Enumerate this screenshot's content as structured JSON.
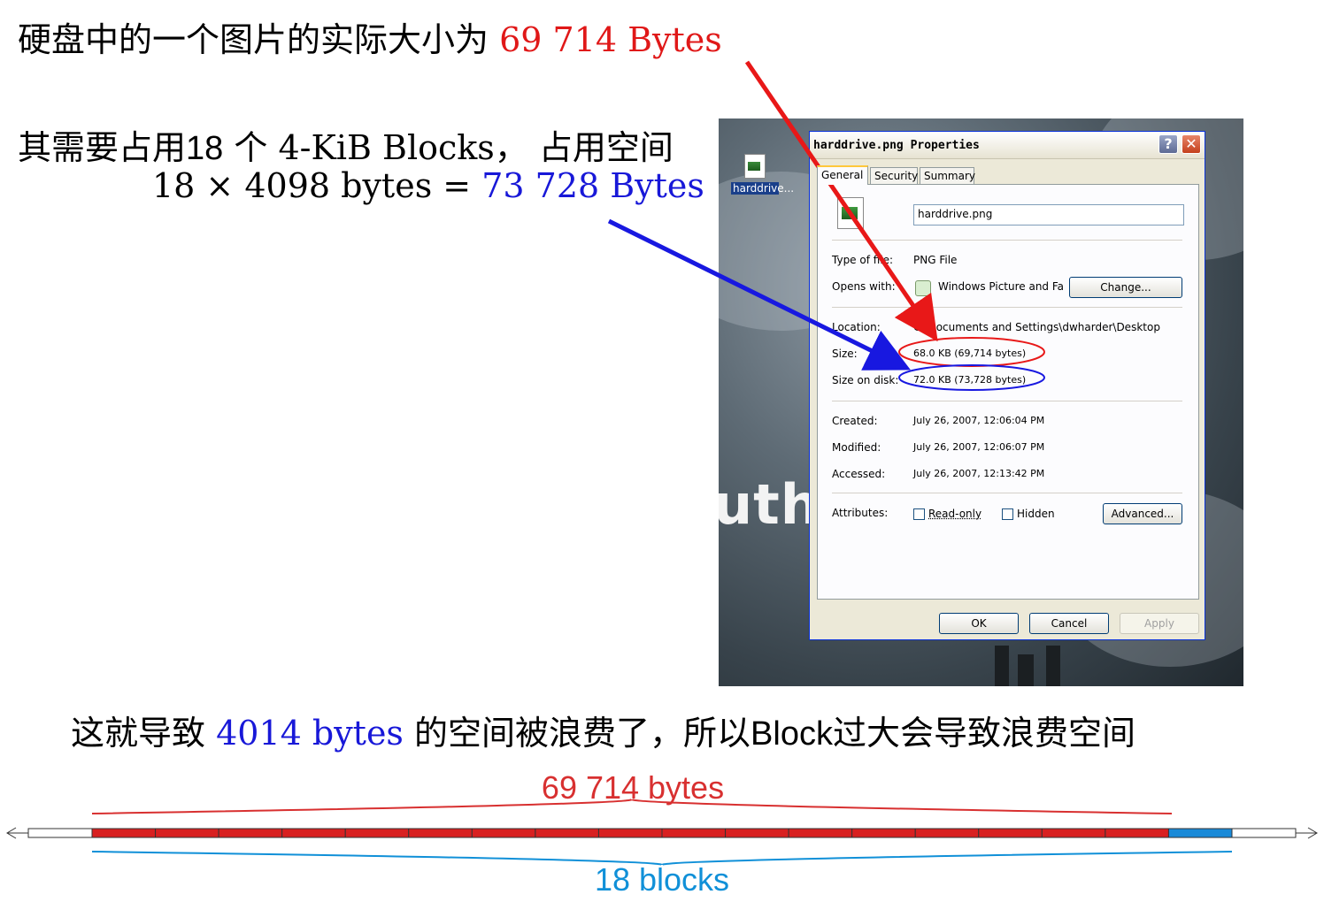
{
  "heading": {
    "line1_prefix": "硬盘中的一个图片的实际大小为 ",
    "line1_value": "69 714 Bytes",
    "line2_a": "其需要占用",
    "line2_b": "18",
    "line2_c": " 个 4-KiB Blocks，  占用空间",
    "line3_prefix": "18 × 4098 bytes = ",
    "line3_value": "73 728 Bytes"
  },
  "conclusion": {
    "prefix": "这就导致 ",
    "value": "4014 bytes",
    "middle": " 的空间被浪费了，所以",
    "block_word": "Block",
    "suffix": "过大会导致浪费空间"
  },
  "desktop": {
    "icon_label": "harddrive...",
    "wallpaper_text": "uth"
  },
  "dialog": {
    "title": "harddrive.png Properties",
    "help_glyph": "?",
    "close_glyph": "✕",
    "tabs": [
      "General",
      "Security",
      "Summary"
    ],
    "filename": "harddrive.png",
    "fields": {
      "type_label": "Type of file:",
      "type_value": "PNG File",
      "opens_label": "Opens with:",
      "opens_value": "Windows Picture and Fa",
      "change_button": "Change...",
      "location_label": "Location:",
      "location_value": "C:\\Documents and Settings\\dwharder\\Desktop",
      "size_label": "Size:",
      "size_value": "68.0 KB (69,714 bytes)",
      "size_on_disk_label": "Size on disk:",
      "size_on_disk_value": "72.0 KB (73,728 bytes)",
      "created_label": "Created:",
      "created_value": "July 26, 2007, 12:06:04 PM",
      "modified_label": "Modified:",
      "modified_value": "July 26, 2007, 12:06:07 PM",
      "accessed_label": "Accessed:",
      "accessed_value": "July 26, 2007, 12:13:42 PM",
      "attributes_label": "Attributes:",
      "readonly_label": "Read-only",
      "hidden_label": "Hidden",
      "advanced_button": "Advanced..."
    },
    "buttons": {
      "ok": "OK",
      "cancel": "Cancel",
      "apply": "Apply"
    }
  },
  "diagram": {
    "bytes_label": "69 714 bytes",
    "blocks_label": "18 blocks",
    "total_blocks": 18,
    "used_blocks": 17,
    "used_color": "#d82020",
    "partial_color": "#1a8ad8"
  }
}
